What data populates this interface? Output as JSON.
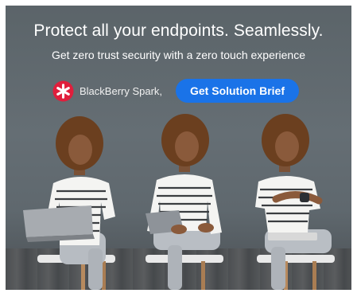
{
  "ad": {
    "headline": "Protect all your endpoints. Seamlessly.",
    "subheadline": "Get zero trust security with a zero touch experience",
    "brand": "BlackBerry Spark,",
    "brand_logo_icon": "blackberry-asterisk-icon",
    "cta_label": "Get Solution Brief"
  },
  "colors": {
    "cta": "#1a73e8",
    "brand_logo": "#e01e3c",
    "background": "#5f686e"
  },
  "people": [
    {
      "device": "laptop"
    },
    {
      "device": "tablet"
    },
    {
      "device": "smartwatch"
    }
  ]
}
